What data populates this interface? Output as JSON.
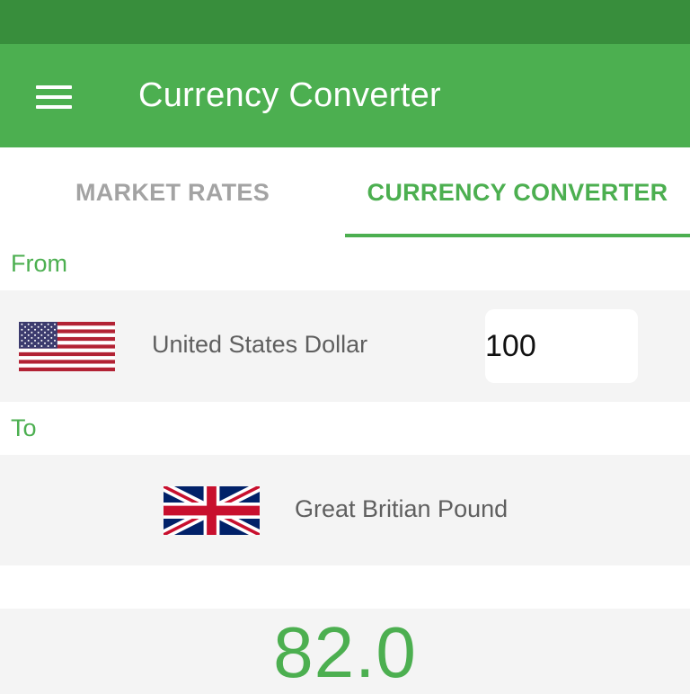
{
  "app_bar": {
    "title": "Currency Converter"
  },
  "tabs": [
    {
      "label": "MARKET RATES",
      "selected": false
    },
    {
      "label": "CURRENCY CONVERTER",
      "selected": true
    }
  ],
  "from": {
    "label": "From",
    "currency_name": "United States Dollar",
    "flag": "us-flag",
    "amount": "100"
  },
  "to": {
    "label": "To",
    "currency_name": "Great Britian Pound",
    "flag": "uk-flag"
  },
  "result": {
    "value": "82.0"
  },
  "colors": {
    "primary": "#4caf50",
    "primary_dark": "#388e3c",
    "row_background": "#f4f4f4",
    "inactive_tab": "#a3a3a3",
    "currency_text": "#5f5f5f"
  }
}
